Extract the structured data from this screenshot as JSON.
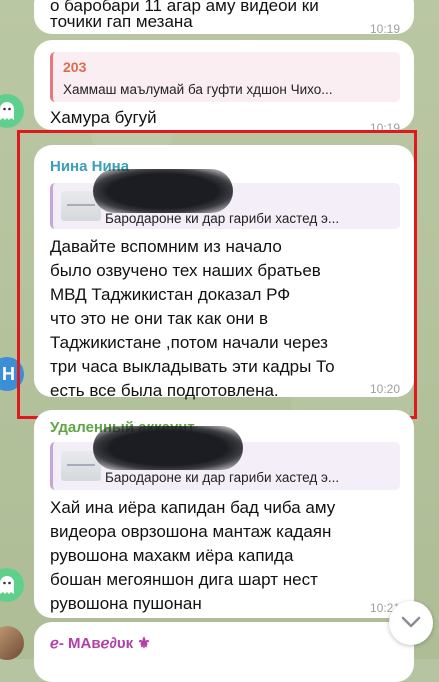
{
  "messages": {
    "top": {
      "text_line1": "о баробари 11 агар аму видеои ки",
      "text_line2": "точики гап мезана",
      "time": "10:19"
    },
    "m203": {
      "reply_title": "203",
      "reply_text": "Хаммаш маълумай ба гуфти хдшон Чихо...",
      "text": "Хамура бугуй",
      "time": "10:19"
    },
    "nina": {
      "sender": "Нина Нина",
      "reply_text": "Бародароне ки дар гариби хастед э...",
      "text": "Давайте вспомним из начало\nбыло озвучено тех наших братьев\nМВД Таджикистан доказал РФ\nчто это не они так как они в\nТаджикистане ,потом начали через\nтри часа выкладывать эти кадры То\nесть все была подготовлена.",
      "time": "10:20"
    },
    "deleted": {
      "sender": "Удаленный аккаунт",
      "reply_text": "Бародароне ки дар гариби хастед э...",
      "text": "Хай ина иёра капидан бад чиба аму\nвидеора оврзошона мантаж кадаян\nрувошона махакм иёра капида\nбошан мегояншон дига шарт нест\nрувошона пушонан",
      "time": "10:21"
    },
    "last": {
      "sender": "ℯ- ΜΑвℯ∂υк ⚜"
    }
  },
  "colors": {
    "nina_sender": "#3a9fb7",
    "deleted_sender": "#5fa544",
    "last_sender": "#b23fa8",
    "highlight": "#e0191e"
  },
  "icons": {
    "avatar": "ghost-avatar-icon",
    "scroll": "chevron-down-icon"
  }
}
